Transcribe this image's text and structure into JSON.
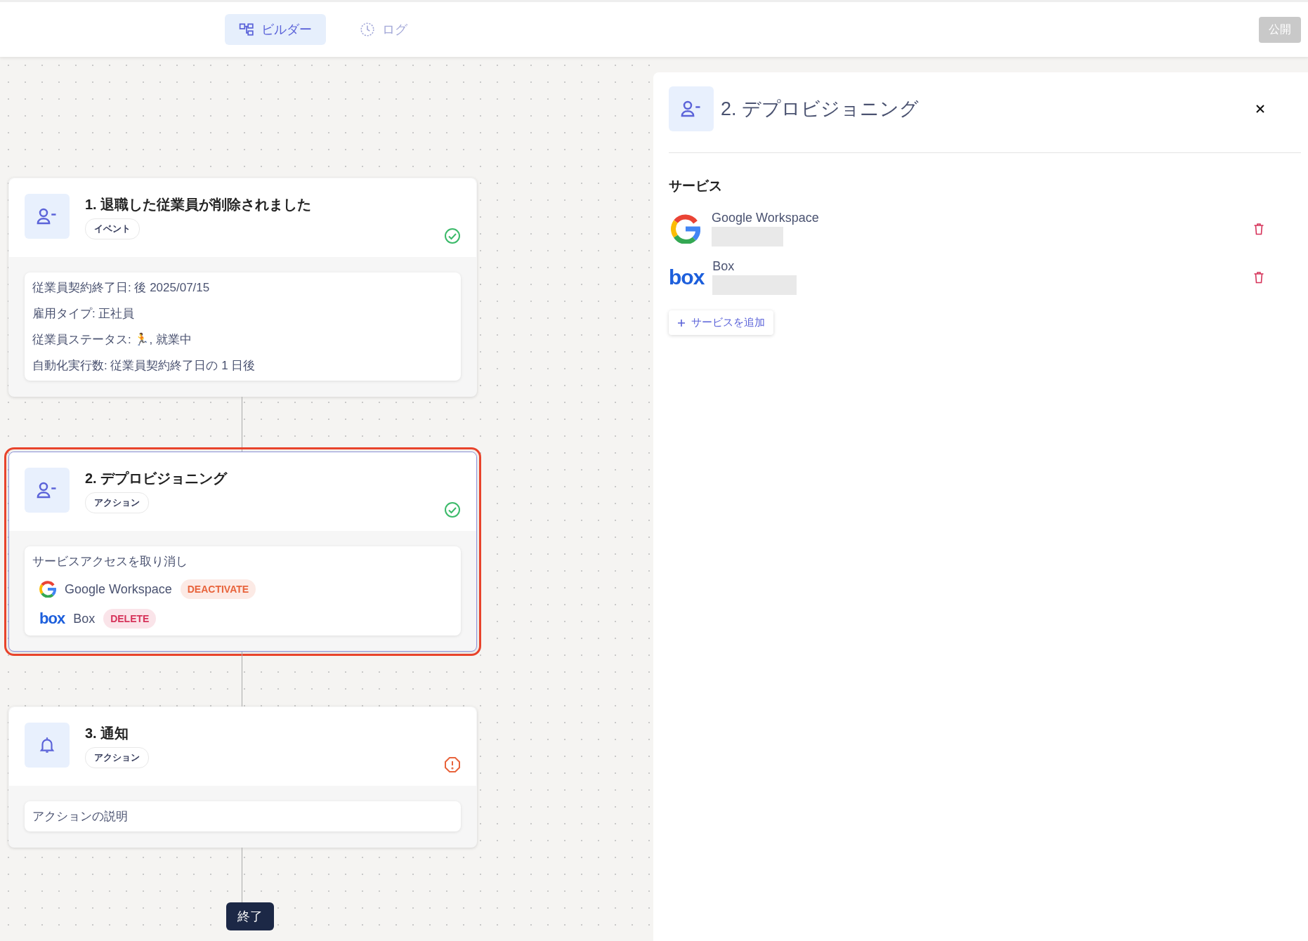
{
  "top_bar": {
    "tabs": [
      {
        "label": "ビルダー",
        "selected": true
      },
      {
        "label": "ログ",
        "selected": false
      }
    ],
    "publish_button": {
      "label": "公開",
      "disabled": true
    }
  },
  "steps": [
    {
      "title": "1. 退職した従業員が削除されました",
      "tag": "イベント",
      "complete": true,
      "selected": false,
      "body": {
        "kind": "conditions",
        "lines": [
          "従業員契約終了日: 後 2025/07/15",
          "雇用タイプ: 正社員",
          "従業員ステータス: 🏃, 就業中",
          "自動化実行数: 従業員契約終了日の 1 日後"
        ]
      }
    },
    {
      "title": "2. デプロビジョニング",
      "tag": "アクション",
      "complete": true,
      "selected": true,
      "body": {
        "kind": "services",
        "intro": "サービスアクセスを取り消し",
        "services": [
          {
            "kind": "google",
            "name": "Google Workspace",
            "action": "DEACTIVATE",
            "color": "#e8643c"
          },
          {
            "kind": "box",
            "wordmark": "box",
            "name": "Box",
            "action": "DELETE",
            "color": "#d6335a"
          }
        ]
      }
    },
    {
      "title": "3. 通知",
      "tag": "アクション",
      "complete": false,
      "selected": false,
      "body": {
        "kind": "description",
        "text": "アクションの説明"
      }
    }
  ],
  "end_label": "終了",
  "panel": {
    "title": "2. デプロビジョニング",
    "section": "サービス",
    "services": [
      {
        "kind": "google",
        "name": "Google Workspace"
      },
      {
        "kind": "box",
        "wordmark": "box",
        "name": "Box"
      }
    ],
    "add_button": "サービスを追加"
  }
}
